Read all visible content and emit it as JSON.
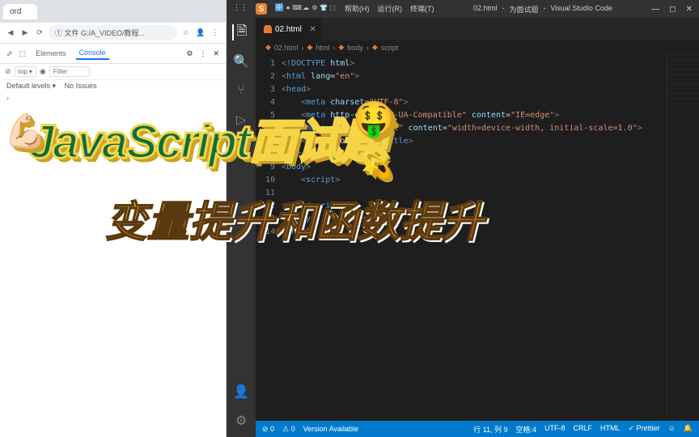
{
  "browser": {
    "tab_title": "ord",
    "address": "G:/A_VIDEO/教程...",
    "addr_prefix": "① 文件",
    "devtools": {
      "tabs": {
        "elements": "Elements",
        "console": "Console"
      },
      "top_label": "top ▾",
      "filter_placeholder": "Filter",
      "levels": "Default levels ▾",
      "issues": "No Issues"
    }
  },
  "vscode": {
    "menu_items": [
      "帮助(H)",
      "运行(R)",
      "终端(T)"
    ],
    "title_file": "02.html",
    "title_project": "为面试题",
    "title_app": "Visual Studio Code",
    "tab_name": "02.html",
    "breadcrumb": [
      "02.html",
      "html",
      "body",
      "script"
    ],
    "code_lines": [
      {
        "n": "1",
        "html": "<span class='c-punc'>&lt;!</span><span class='c-doc'>DOCTYPE</span> <span class='c-attr'>html</span><span class='c-punc'>&gt;</span>"
      },
      {
        "n": "2",
        "html": "<span class='c-punc'>&lt;</span><span class='c-tag'>html</span> <span class='c-attr'>lang</span>=<span class='c-str'>\"en\"</span><span class='c-punc'>&gt;</span>"
      },
      {
        "n": "3",
        "html": "<span class='c-punc'>&lt;</span><span class='c-tag'>head</span><span class='c-punc'>&gt;</span>"
      },
      {
        "n": "4",
        "html": "    <span class='c-punc'>&lt;</span><span class='c-tag'>meta</span> <span class='c-attr'>charset</span>=<span class='c-str'>\"UTF-8\"</span><span class='c-punc'>&gt;</span>"
      },
      {
        "n": "5",
        "html": "    <span class='c-punc'>&lt;</span><span class='c-tag'>meta</span> <span class='c-attr'>http-equiv</span>=<span class='c-str'>\"X-UA-Compatible\"</span> <span class='c-attr'>content</span>=<span class='c-str'>\"IE=edge\"</span><span class='c-punc'>&gt;</span>"
      },
      {
        "n": "6",
        "html": "    <span class='c-punc'>&lt;</span><span class='c-tag'>meta</span> <span class='c-attr'>name</span>=<span class='c-str'>\"viewport\"</span> <span class='c-attr'>content</span>=<span class='c-str'>\"width=device-width, initial-scale=1.0\"</span><span class='c-punc'>&gt;</span>"
      },
      {
        "n": "7",
        "html": "    <span class='c-punc'>&lt;</span><span class='c-tag'>title</span><span class='c-punc'>&gt;</span><span class='c-text'>Document</span><span class='c-punc'>&lt;/</span><span class='c-tag'>title</span><span class='c-punc'>&gt;</span>"
      },
      {
        "n": "8",
        "html": "<span class='c-punc'>&lt;/</span><span class='c-tag'>head</span><span class='c-punc'>&gt;</span>"
      },
      {
        "n": "9",
        "html": "<span class='c-punc'>&lt;</span><span class='c-tag'>body</span><span class='c-punc'>&gt;</span>"
      },
      {
        "n": "10",
        "html": "    <span class='c-punc'>&lt;</span><span class='c-tag'>script</span><span class='c-punc'>&gt;</span>"
      },
      {
        "n": "11",
        "html": ""
      },
      {
        "n": "12",
        "html": "    <span class='c-punc'>&lt;/</span><span class='c-tag'>script</span><span class='c-punc'>&gt;</span>"
      },
      {
        "n": "13",
        "html": "<span class='c-punc'>&lt;/</span><span class='c-tag'>body</span><span class='c-punc'>&gt;</span>"
      },
      {
        "n": "14",
        "html": "<span class='c-punc'>&lt;/</span><span class='c-tag'>html</span><span class='c-punc'>&gt;</span>"
      }
    ],
    "statusbar": {
      "errors": "⊘ 0",
      "warnings": "⚠ 0",
      "version": "Version Available",
      "position": "行 11, 列 9",
      "spaces": "空格:4",
      "encoding": "UTF-8",
      "eol": "CRLF",
      "lang": "HTML",
      "prettier": "✓ Prettier"
    }
  },
  "overlay": {
    "title1": "JavaScript面试题",
    "title2": "变量提升和函数提升"
  }
}
